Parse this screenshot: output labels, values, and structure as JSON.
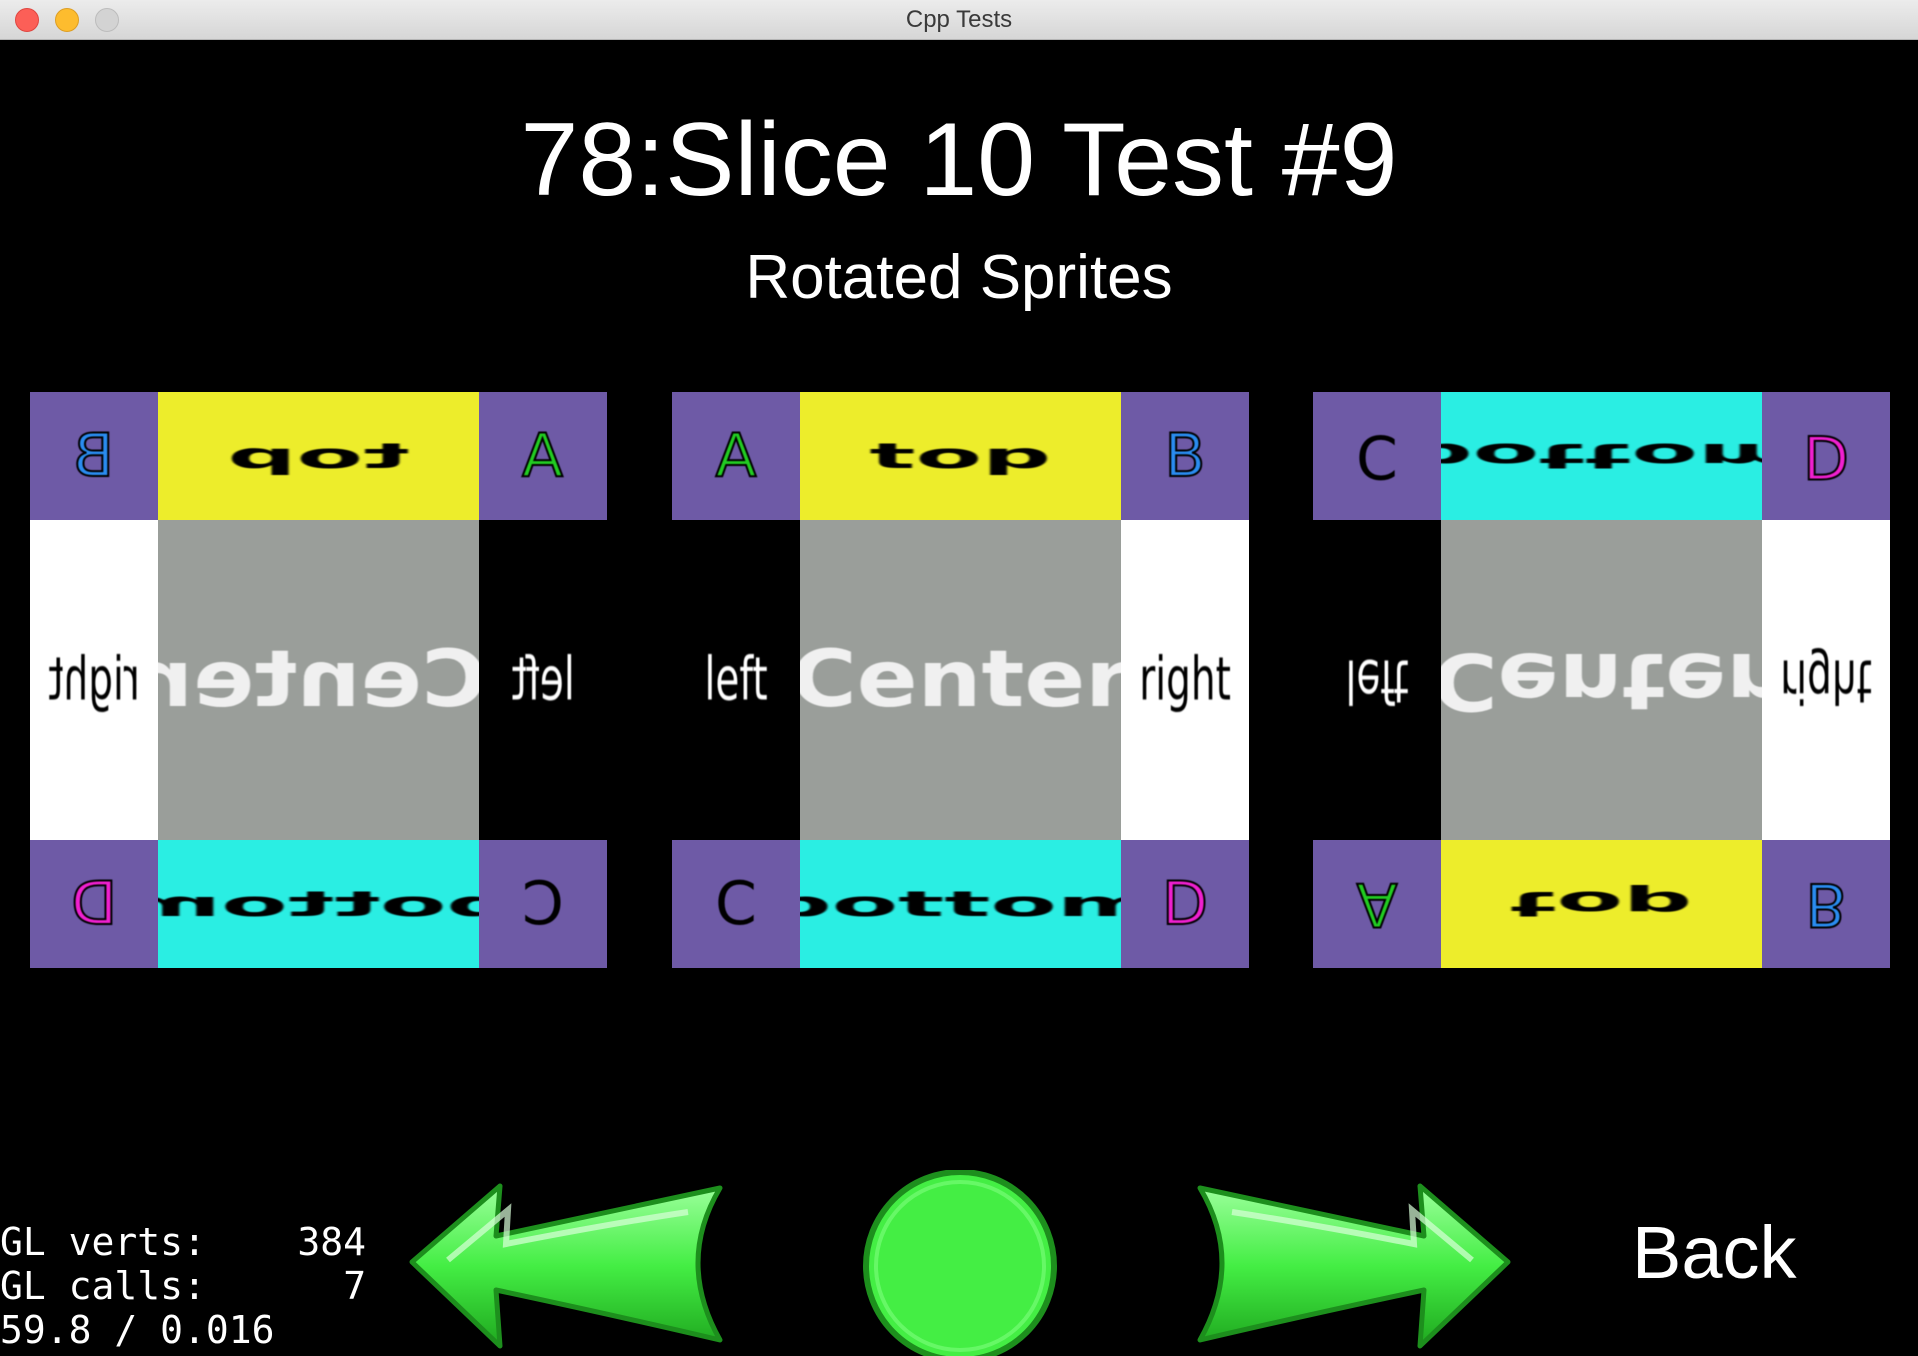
{
  "window": {
    "title": "Cpp Tests",
    "buttons": {
      "close": "close",
      "minimize": "minimize",
      "zoom": "zoom"
    }
  },
  "test": {
    "title": "78:Slice 10 Test #9",
    "subtitle": "Rotated Sprites"
  },
  "sprites": [
    {
      "variant": "flipped-x",
      "corners": {
        "tl": "B",
        "tr": "A",
        "bl": "D",
        "br": "C"
      },
      "edges": {
        "top": "top",
        "bottom": "bottom",
        "left": "right",
        "right": "left"
      },
      "center": "Center"
    },
    {
      "variant": "normal",
      "corners": {
        "tl": "A",
        "tr": "B",
        "bl": "C",
        "br": "D"
      },
      "edges": {
        "top": "top",
        "bottom": "bottom",
        "left": "left",
        "right": "right"
      },
      "center": "Center"
    },
    {
      "variant": "flipped-y",
      "corners": {
        "tl": "C",
        "tr": "D",
        "bl": "A",
        "br": "B"
      },
      "edges": {
        "top": "bottom",
        "bottom": "top",
        "left": "left",
        "right": "right"
      },
      "center": "Center"
    }
  ],
  "stats": {
    "verts_label": "GL verts:",
    "verts_value": "384",
    "calls_label": "GL calls:",
    "calls_value": "7",
    "fps_line": "59.8 / 0.016"
  },
  "nav": {
    "prev_icon": "left-arrow-icon",
    "restart_icon": "restart-circle-icon",
    "next_icon": "right-arrow-icon",
    "back_label": "Back"
  },
  "colors": {
    "corner": "#6e5aa6",
    "top_edge": "#eded2b",
    "bottom_edge": "#2aeee3",
    "center": "#9a9e9a",
    "left_edge_bg": "#000000",
    "right_edge_bg": "#ffffff",
    "letter_A": "#000000",
    "letter_A_fill": "#22cc22",
    "letter_B": "#2a8cf0",
    "letter_C": "#000000",
    "letter_D": "#f020d0",
    "nav_green": "#44ee44"
  }
}
